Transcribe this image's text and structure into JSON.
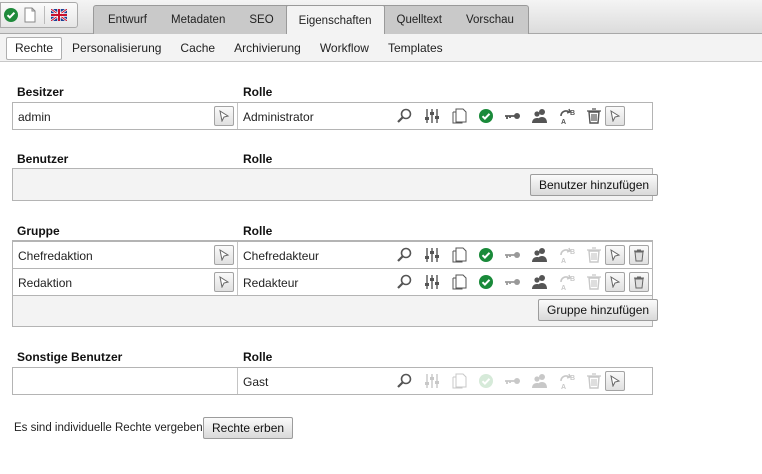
{
  "toolbar": {
    "icons": [
      "check-circle-icon",
      "new-page-icon",
      "uk-flag-icon"
    ]
  },
  "tabs": [
    {
      "label": "Entwurf",
      "active": false
    },
    {
      "label": "Metadaten",
      "active": false
    },
    {
      "label": "SEO",
      "active": false
    },
    {
      "label": "Eigenschaften",
      "active": true
    },
    {
      "label": "Quelltext",
      "active": false
    },
    {
      "label": "Vorschau",
      "active": false
    }
  ],
  "subtabs": [
    {
      "label": "Rechte",
      "active": true
    },
    {
      "label": "Personalisierung",
      "active": false
    },
    {
      "label": "Cache",
      "active": false
    },
    {
      "label": "Archivierung",
      "active": false
    },
    {
      "label": "Workflow",
      "active": false
    },
    {
      "label": "Templates",
      "active": false
    }
  ],
  "owner": {
    "heading": "Besitzer",
    "role_heading": "Rolle",
    "name": "admin",
    "role": "Administrator"
  },
  "users": {
    "heading": "Benutzer",
    "role_heading": "Rolle",
    "add_button": "Benutzer hinzufügen"
  },
  "groups": {
    "heading": "Gruppe",
    "role_heading": "Rolle",
    "rows": [
      {
        "name": "Chefredaktion",
        "role": "Chefredakteur"
      },
      {
        "name": "Redaktion",
        "role": "Redakteur"
      }
    ],
    "add_button": "Gruppe hinzufügen"
  },
  "others": {
    "heading": "Sonstige Benutzer",
    "role_heading": "Rolle",
    "name": "",
    "role": "Gast"
  },
  "footer": {
    "text": "Es sind individuelle Rechte vergeben.",
    "inherit_button": "Rechte erben"
  },
  "permission_icons": [
    "read-icon",
    "settings-icon",
    "copy-icon",
    "publish-icon",
    "key-icon",
    "users-icon",
    "translate-icon",
    "delete-icon"
  ],
  "colors": {
    "accent_green": "#1a8a3a",
    "active_icon": "#555555",
    "disabled_icon": "#c8c8c8"
  }
}
